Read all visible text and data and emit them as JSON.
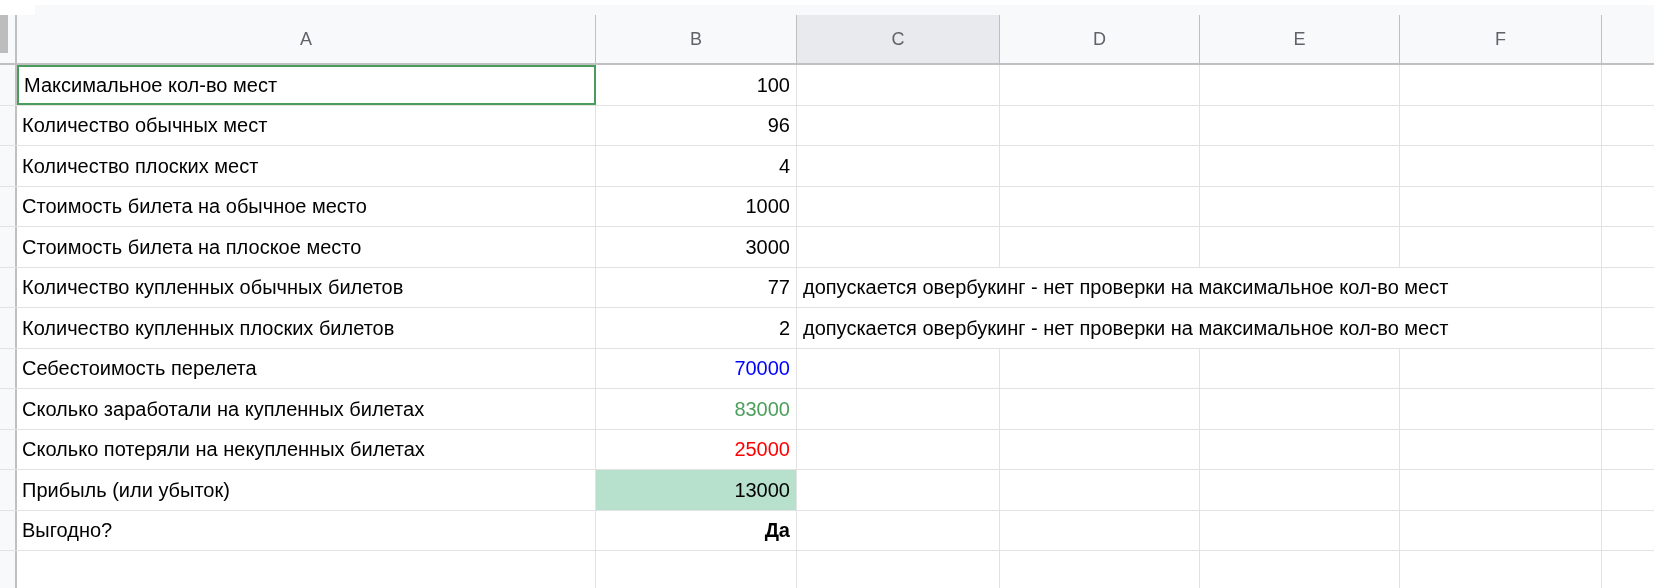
{
  "columns": [
    {
      "label": "A",
      "selected": false
    },
    {
      "label": "B",
      "selected": false
    },
    {
      "label": "C",
      "selected": true
    },
    {
      "label": "D",
      "selected": false
    },
    {
      "label": "E",
      "selected": false
    },
    {
      "label": "F",
      "selected": false
    }
  ],
  "rows": [
    {
      "label": "Максимальное кол-во мест",
      "value": "100",
      "selected": true
    },
    {
      "label": "Количество обычных мест",
      "value": "96",
      "selected": false
    },
    {
      "label": "Количество плоских мест",
      "value": "4",
      "selected": false
    },
    {
      "label": "Стоимость билета на обычное место",
      "value": "1000",
      "selected": false
    },
    {
      "label": "Стоимость билета на плоское место",
      "value": "3000",
      "selected": false
    },
    {
      "label": "Количество купленных обычных билетов",
      "value": "77",
      "selected": false,
      "note": "допускается овербукинг - нет проверки на максимальное кол-во мест"
    },
    {
      "label": "Количество купленных плоских билетов",
      "value": "2",
      "selected": false,
      "note": "допускается овербукинг - нет проверки на максимальное кол-во мест"
    },
    {
      "label": "Себестоимость перелета",
      "value": "70000",
      "selected": false,
      "color": "#0000ff"
    },
    {
      "label": "Сколько заработали на купленных билетах",
      "value": "83000",
      "selected": false,
      "color": "#4c9e5b"
    },
    {
      "label": "Сколько потеряли на некупленных билетах",
      "value": "25000",
      "selected": false,
      "color": "#ff0000"
    },
    {
      "label": "Прибыль (или убыток)",
      "value": "13000",
      "selected": false,
      "highlighted": true
    },
    {
      "label": "Выгодно?",
      "value": "Да",
      "selected": false,
      "bold": true
    }
  ]
}
